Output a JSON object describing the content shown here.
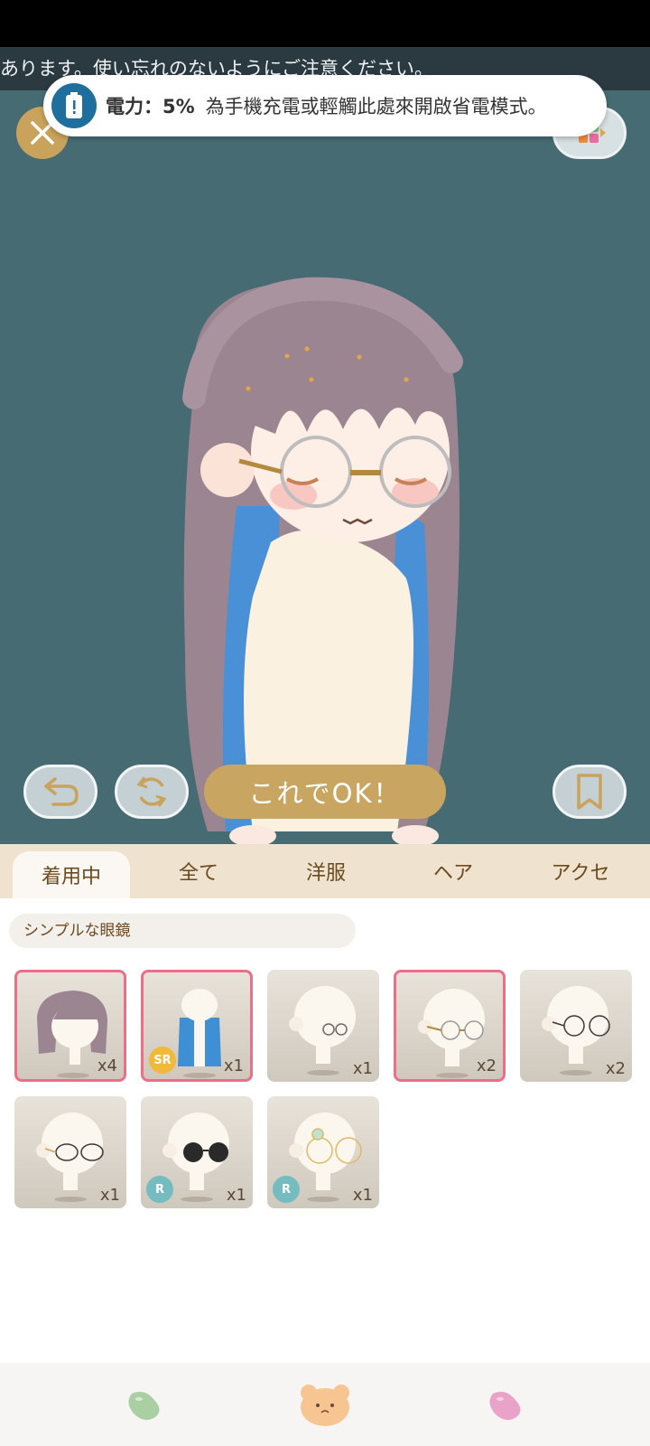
{
  "marquee": {
    "text": "あります。使い忘れのないようにご注意ください。"
  },
  "toast": {
    "label": "電力：5%",
    "message": "為手機充電或輕觸此處來開啟省電模式。"
  },
  "controls": {
    "ok_label": "これでOK！"
  },
  "tabs": [
    {
      "label": "着用中",
      "active": true
    },
    {
      "label": "全て",
      "active": false
    },
    {
      "label": "洋服",
      "active": false
    },
    {
      "label": "ヘア",
      "active": false
    },
    {
      "label": "アクセ",
      "active": false
    }
  ],
  "category": {
    "label": "シンプルな眼鏡"
  },
  "items": [
    {
      "kind": "hair-braid",
      "count": "x4",
      "selected": true,
      "rarity": ""
    },
    {
      "kind": "hair-blue",
      "count": "x1",
      "selected": true,
      "rarity": "SR"
    },
    {
      "kind": "glasses-small-round",
      "count": "x1",
      "selected": false,
      "rarity": ""
    },
    {
      "kind": "glasses-gold-round",
      "count": "x2",
      "selected": true,
      "rarity": ""
    },
    {
      "kind": "glasses-thin-round",
      "count": "x2",
      "selected": false,
      "rarity": ""
    },
    {
      "kind": "glasses-oval",
      "count": "x1",
      "selected": false,
      "rarity": ""
    },
    {
      "kind": "sunglasses-round",
      "count": "x1",
      "selected": false,
      "rarity": "R"
    },
    {
      "kind": "glasses-gold-jewel",
      "count": "x1",
      "selected": false,
      "rarity": "R"
    }
  ],
  "nav": [
    {
      "icon": "green-bean-icon"
    },
    {
      "icon": "bear-face-icon"
    },
    {
      "icon": "pink-bean-icon"
    }
  ],
  "colors": {
    "stage_bg": "#466b72",
    "accent_gold": "#c8a560",
    "select_pink": "#ec6f8a",
    "tab_bg": "#efe2cf"
  }
}
